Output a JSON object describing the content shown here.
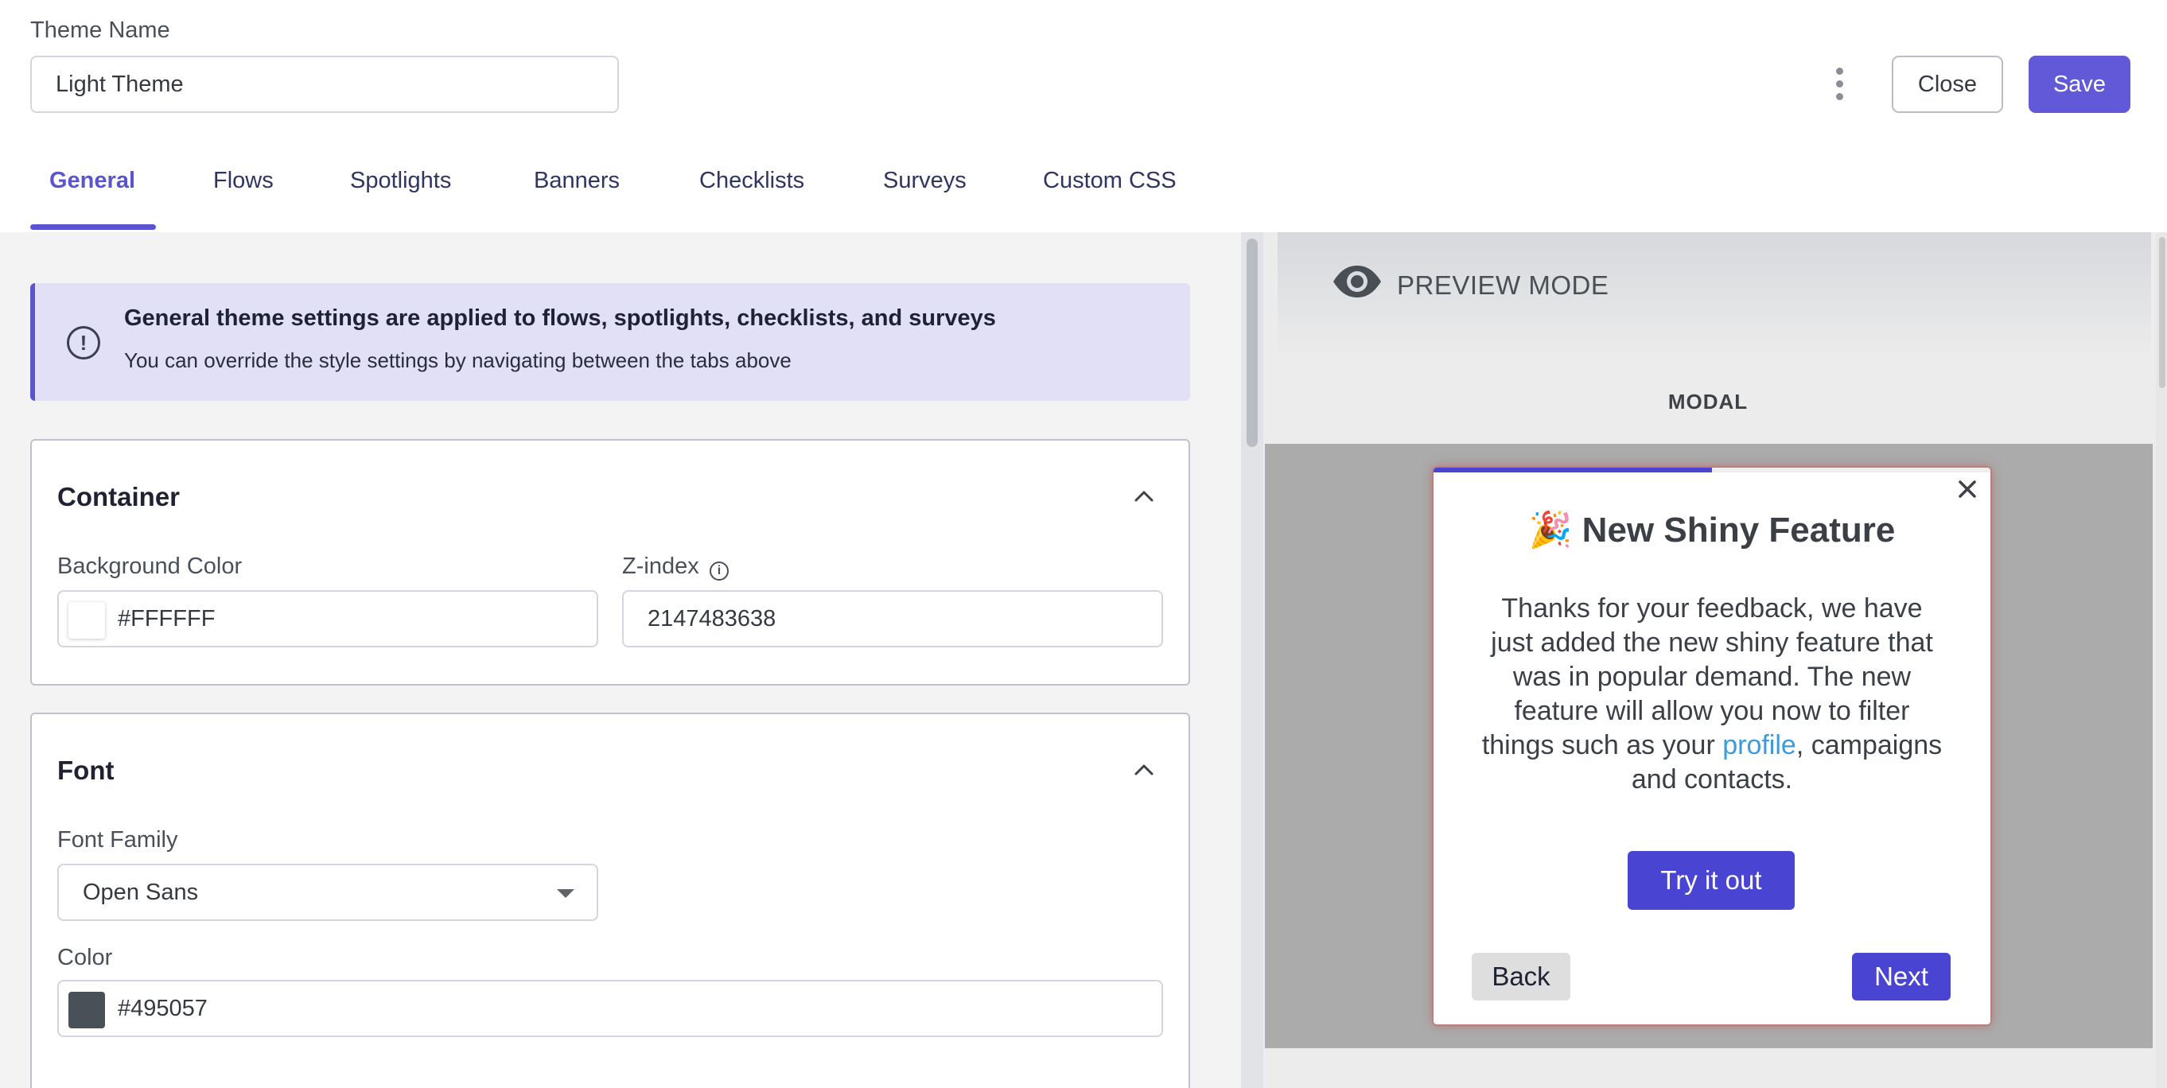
{
  "header": {
    "theme_name_label": "Theme Name",
    "theme_name_value": "Light Theme",
    "close_label": "Close",
    "save_label": "Save",
    "more_icon": "more-vertical-icon"
  },
  "tabs": [
    {
      "label": "General",
      "active": true
    },
    {
      "label": "Flows",
      "active": false
    },
    {
      "label": "Spotlights",
      "active": false
    },
    {
      "label": "Banners",
      "active": false
    },
    {
      "label": "Checklists",
      "active": false
    },
    {
      "label": "Surveys",
      "active": false
    },
    {
      "label": "Custom CSS",
      "active": false
    }
  ],
  "info_banner": {
    "title": "General theme settings are applied to flows, spotlights, checklists, and surveys",
    "subtitle": "You can override the style settings by navigating between the tabs above",
    "icon": "alert-circle-icon"
  },
  "container_section": {
    "title": "Container",
    "background_color_label": "Background Color",
    "background_color_value": "#FFFFFF",
    "zindex_label": "Z-index",
    "zindex_value": "2147483638"
  },
  "font_section": {
    "title": "Font",
    "font_family_label": "Font Family",
    "font_family_value": "Open Sans",
    "color_label": "Color",
    "color_value": "#495057"
  },
  "preview": {
    "mode_label": "PREVIEW MODE",
    "type_label": "MODAL",
    "modal": {
      "emoji": "🎉",
      "title": "New Shiny Feature",
      "body_before_link": "Thanks for your feedback, we have just added the new shiny feature that was in popular demand. The new feature will allow you now to filter things such as your ",
      "body_link": "profile",
      "body_after_link": ", campaigns and contacts.",
      "cta_label": "Try it out",
      "back_label": "Back",
      "next_label": "Next",
      "progress": 0.5
    }
  },
  "colors": {
    "accent": "#5B54D1",
    "save_button": "#6259D9",
    "modal_button": "#4A44D2",
    "banner_bg": "#E2E0F7",
    "link": "#3B9BDC"
  }
}
